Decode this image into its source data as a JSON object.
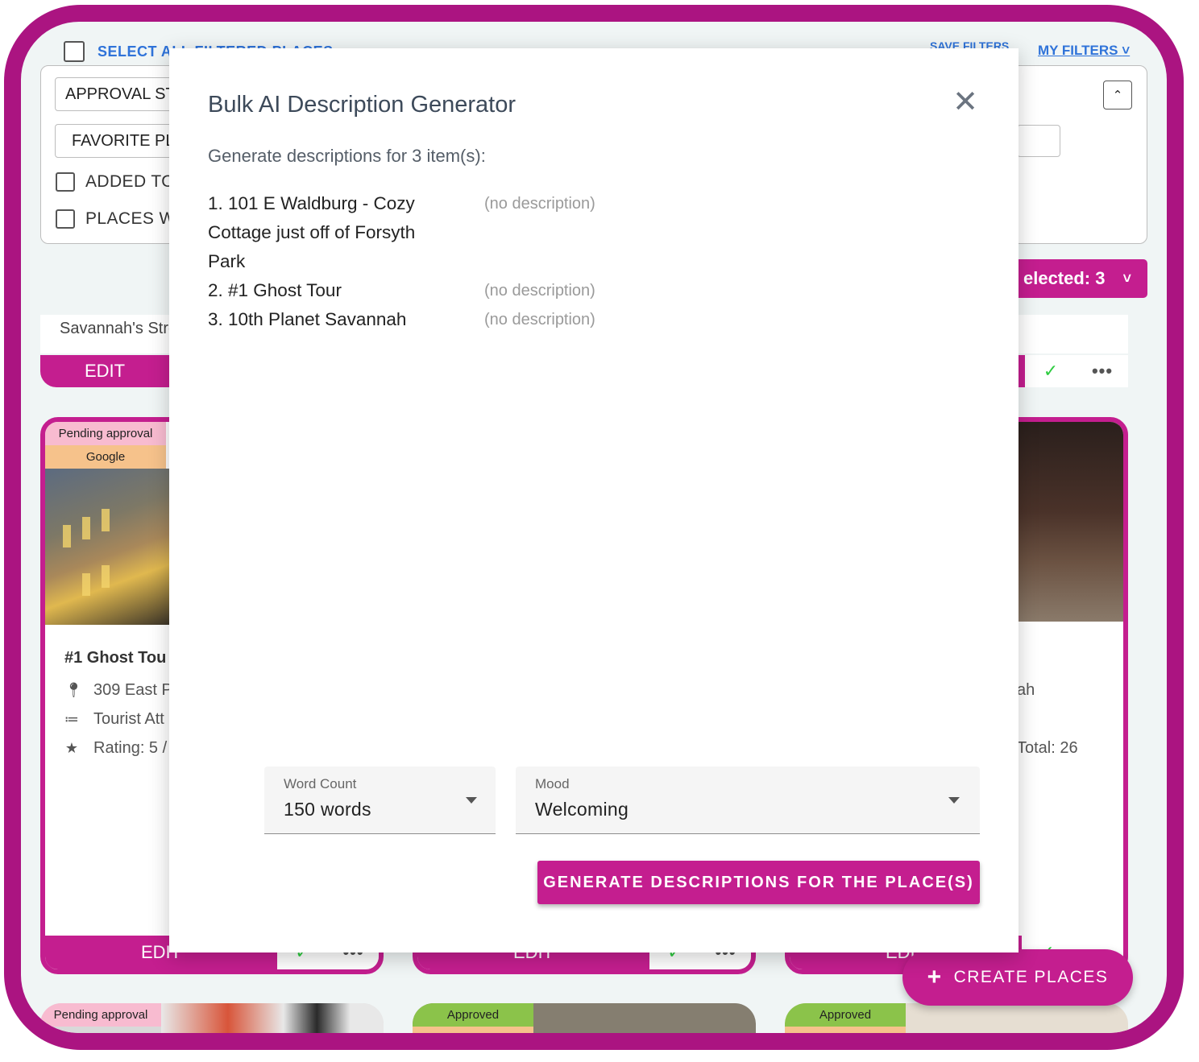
{
  "background": {
    "select_all_label": "SELECT ALL FILTERED PLACES",
    "save_filters_label": "SAVE FILTERS",
    "my_filters_label": "MY FILTERS",
    "filters": {
      "approval_status": "APPROVAL ST",
      "favorite_places": "FAVORITE PL",
      "added_to": "ADDED TO",
      "places_with": "PLACES WI"
    },
    "selected_label": "elected: 3",
    "strip_text": "Savannah's Stre",
    "edit_label": "EDIT",
    "cards": [
      {
        "badges": [
          "Pending approval",
          "Google"
        ],
        "title": "#1 Ghost Tou",
        "address": "309 East P",
        "category": "Tourist Att",
        "rating": "Rating: 5 /"
      },
      {
        "right_fragment_address": "ah",
        "right_fragment_total": "Total: 26"
      }
    ],
    "bottom_badges": [
      "Pending approval",
      "Approved",
      "Approved"
    ],
    "fab_label": "CREATE PLACES"
  },
  "modal": {
    "title": "Bulk AI Description Generator",
    "subtitle": "Generate descriptions for 3 item(s):",
    "items": [
      {
        "name": "1. 101 E Waldburg - Cozy Cottage just off of Forsyth Park",
        "desc": "(no description)"
      },
      {
        "name": "2. #1 Ghost Tour",
        "desc": "(no description)"
      },
      {
        "name": "3. 10th Planet Savannah",
        "desc": "(no description)"
      }
    ],
    "word_count": {
      "label": "Word Count",
      "value": "150 words"
    },
    "mood": {
      "label": "Mood",
      "value": "Welcoming"
    },
    "generate_label": "GENERATE DESCRIPTIONS FOR THE PLACE(S)"
  },
  "colors": {
    "accent": "#c41e8f",
    "frame": "#ab1481",
    "link": "#2f73d9",
    "approved": "#8bc34a",
    "pending": "#f8bbd0",
    "google": "#f6c28b"
  }
}
